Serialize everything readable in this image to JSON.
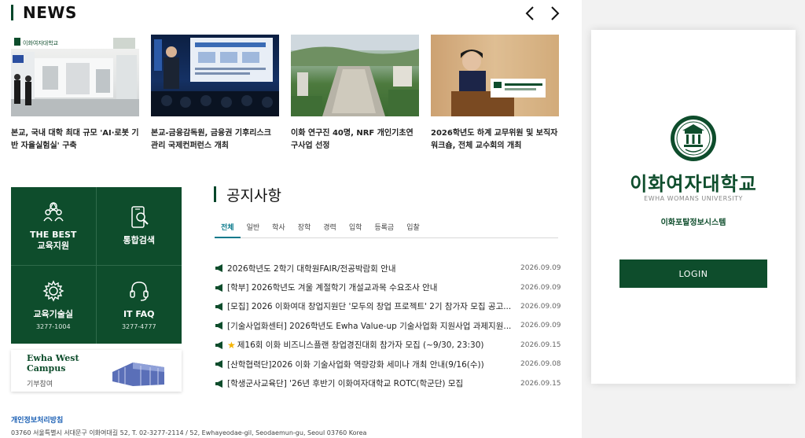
{
  "news": {
    "title": "NEWS",
    "items": [
      {
        "title": "본교, 국내 대학 최대 규모 'AI·로봇 기반 자율실험실' 구축",
        "thumb_sign": "이화여자대학교"
      },
      {
        "title": "본교-금융감독원, 금융권 기후리스크 관리 국제컨퍼런스 개최"
      },
      {
        "title": "이화 연구진 40명, NRF 개인기초연구사업 선정"
      },
      {
        "title": "2026학년도 하계 교무위원 및 보직자 워크숍, 전체 교수회의 개최"
      }
    ]
  },
  "quick": {
    "items": [
      {
        "label": "THE BEST\n교육지원",
        "sub": "",
        "icon": "people-icon"
      },
      {
        "label": "통합검색",
        "sub": "",
        "icon": "mobile-search-icon"
      },
      {
        "label": "교육기술실",
        "sub": "3277-1004",
        "icon": "gear-icon"
      },
      {
        "label": "IT FAQ",
        "sub": "3277-4777",
        "icon": "headset-icon"
      }
    ]
  },
  "west": {
    "title": "Ewha West Campus",
    "sub": "기부참여"
  },
  "notice": {
    "title": "공지사항",
    "tabs": [
      "전체",
      "일반",
      "학사",
      "장학",
      "경력",
      "입학",
      "등록금",
      "입찰"
    ],
    "active_tab": 0,
    "items": [
      {
        "text": "2026학년도 2학기 대학원FAIR/전공박람회 안내",
        "date": "2026.09.09"
      },
      {
        "text": "[학부] 2026학년도 겨울 계절학기 개설교과목 수요조사 안내",
        "date": "2026.09.09"
      },
      {
        "text": "[모집] 2026 이화여대 창업지원단 '모두의 창업 프로젝트' 2기 참가자 모집 공고...",
        "date": "2026.09.09"
      },
      {
        "text": "[기술사업화센터] 2026학년도 Ewha Value-up 기술사업화 지원사업 과제지원...",
        "date": "2026.09.09"
      },
      {
        "text": "제16회 이화 비즈니스플랜 창업경진대회 참가자 모집 (~9/30, 23:30)",
        "date": "2026.09.15",
        "star": true
      },
      {
        "text": "[산학협력단]2026 이화 기술사업화 역량강화 세미나 개최 안내(9/16(수))",
        "date": "2026.09.08"
      },
      {
        "text": "[학생군사교육단] '26년 후반기 이화여자대학교 ROTC(학군단) 모집",
        "date": "2026.09.15"
      }
    ]
  },
  "footer": {
    "privacy": "개인정보처리방침",
    "address": "03760 서울특별시 서대문구 이화여대길 52, T. 02-3277-2114 / 52, Ewhayeodae-gil, Seodaemun-gu, Seoul 03760 Korea"
  },
  "login_panel": {
    "university_ko": "이화여자대학교",
    "university_en": "EWHA WOMANS UNIVERSITY",
    "portal": "이화포탈정보시스템",
    "login_label": "LOGIN"
  },
  "colors": {
    "brand": "#0e4d2c",
    "tab_active": "#0a7a8c",
    "link": "#1a5fb4"
  }
}
